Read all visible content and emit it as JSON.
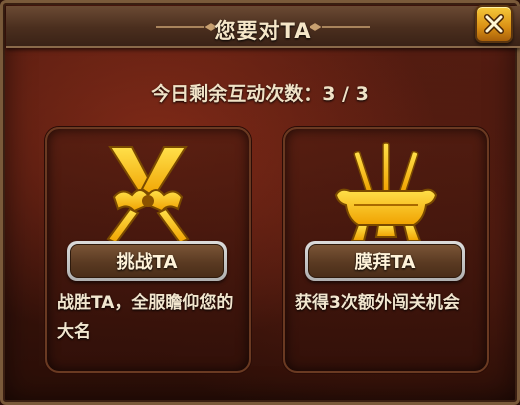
{
  "dialog": {
    "title": "您要对TA",
    "remaining_text": "今日剩余互动次数：3 / 3"
  },
  "cards": [
    {
      "icon": "crossed-swords-icon",
      "button_label": "挑战TA",
      "description": "战胜TA，全服瞻仰您的大名"
    },
    {
      "icon": "incense-burner-icon",
      "button_label": "膜拜TA",
      "description": "获得3次额外闯关机会"
    }
  ],
  "colors": {
    "accent_gold": "#f5b400",
    "panel_dark_red": "#3b140c",
    "text_cream": "#f2e6cf"
  }
}
